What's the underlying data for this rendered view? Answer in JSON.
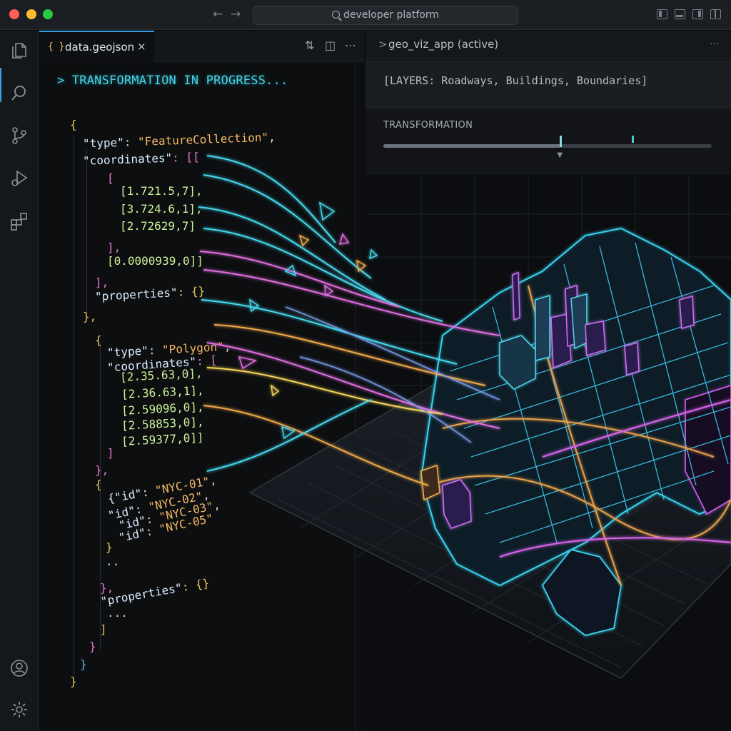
{
  "titlebar": {
    "search_text": "developer platform"
  },
  "editor": {
    "tab_icon": "{ }",
    "tab_label": "data.geojson",
    "tab_close": "×",
    "status_line": "> TRANSFORMATION IN PROGRESS...",
    "code": {
      "l01": "{",
      "l02_key": "\"type\"",
      "l02_val": "\"FeatureCollection\"",
      "l03_key": "\"coordinates\"",
      "l03_rest": ": [[",
      "l04": "[",
      "l05": "[1.721.5,7],",
      "l06": "[3.724.6,1],",
      "l07": "[2.72629,7]",
      "l08": "],",
      "l09": "[0.0000939,0]]",
      "l10": "],",
      "l11_key": "\"properties\"",
      "l11_rest": ": {}",
      "l12": "},",
      "l13": "{",
      "l14_key": "\"type\"",
      "l14_val": "\"Polygon\"",
      "l15_key": "\"coordinates\"",
      "l15_rest": ": [",
      "l16": "[2.35.63,0],",
      "l17": "[2.36.63,1],",
      "l18": "[2.59096,0],",
      "l19": "[2.58853,0],",
      "l20": "[2.59377,0]]",
      "l21": "]",
      "l22": "},",
      "l23": "{",
      "l24_key": "{\"id\"",
      "l24_val": "\"NYC-01\"",
      "l25_key": "\"id\"",
      "l25_val": "\"NYC-02\"",
      "l26_key": "\"id\"",
      "l26_val": "\"NYC-03\"",
      "l27_key": "\"id\"",
      "l27_val": "\"NYC-05\"",
      "l28": "}",
      "l29": "..",
      "l30": "},",
      "l31_key": "\"properties\"",
      "l31_rest": ": {}",
      "l32": "...",
      "l33": "]",
      "l34": "}",
      "l35": "}",
      "l36": "}"
    }
  },
  "viz_panel": {
    "tab_label": "geo_viz_app (active)",
    "tab_chevron": ">",
    "more": "...",
    "layers": "[LAYERS: Roadways, Buildings, Boundaries]",
    "transformation_label": "TRANSFORMATION",
    "transformation_value": 0.54
  },
  "colors": {
    "accent": "#3b9ee8",
    "cyan": "#42d7ea",
    "magenta": "#e05ce0",
    "orange": "#f5a442"
  },
  "icons": [
    "files-icon",
    "search-icon",
    "source-control-icon",
    "run-debug-icon",
    "extensions-icon",
    "account-icon",
    "settings-icon"
  ]
}
